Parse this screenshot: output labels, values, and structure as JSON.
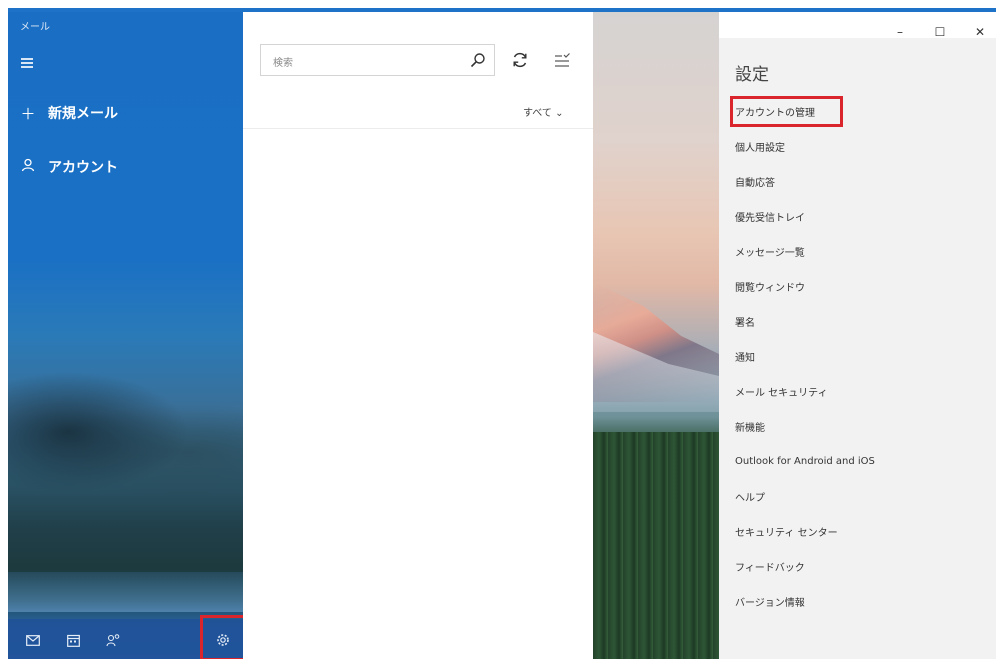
{
  "app": {
    "title": "メール"
  },
  "nav": {
    "new_mail_label": "新規メール",
    "account_label": "アカウント",
    "bottom_icons": [
      "mail-icon",
      "calendar-icon",
      "people-icon",
      "gear-icon"
    ]
  },
  "list": {
    "search_placeholder": "検索",
    "filter_label": "すべて ⌄"
  },
  "window_controls": {
    "minimize": "–",
    "maximize": "☐",
    "close": "✕"
  },
  "settings": {
    "title": "設定",
    "items": [
      "アカウントの管理",
      "個人用設定",
      "自動応答",
      "優先受信トレイ",
      "メッセージ一覧",
      "閲覧ウィンドウ",
      "署名",
      "通知",
      "メール セキュリティ",
      "新機能",
      "Outlook for Android and iOS",
      "ヘルプ",
      "セキュリティ センター",
      "フィードバック",
      "バージョン情報"
    ],
    "highlighted_item": "アカウントの管理"
  },
  "colors": {
    "accent": "#1e73c9",
    "highlight_border": "#d9252b",
    "settings_bg": "#f2f2f2"
  }
}
